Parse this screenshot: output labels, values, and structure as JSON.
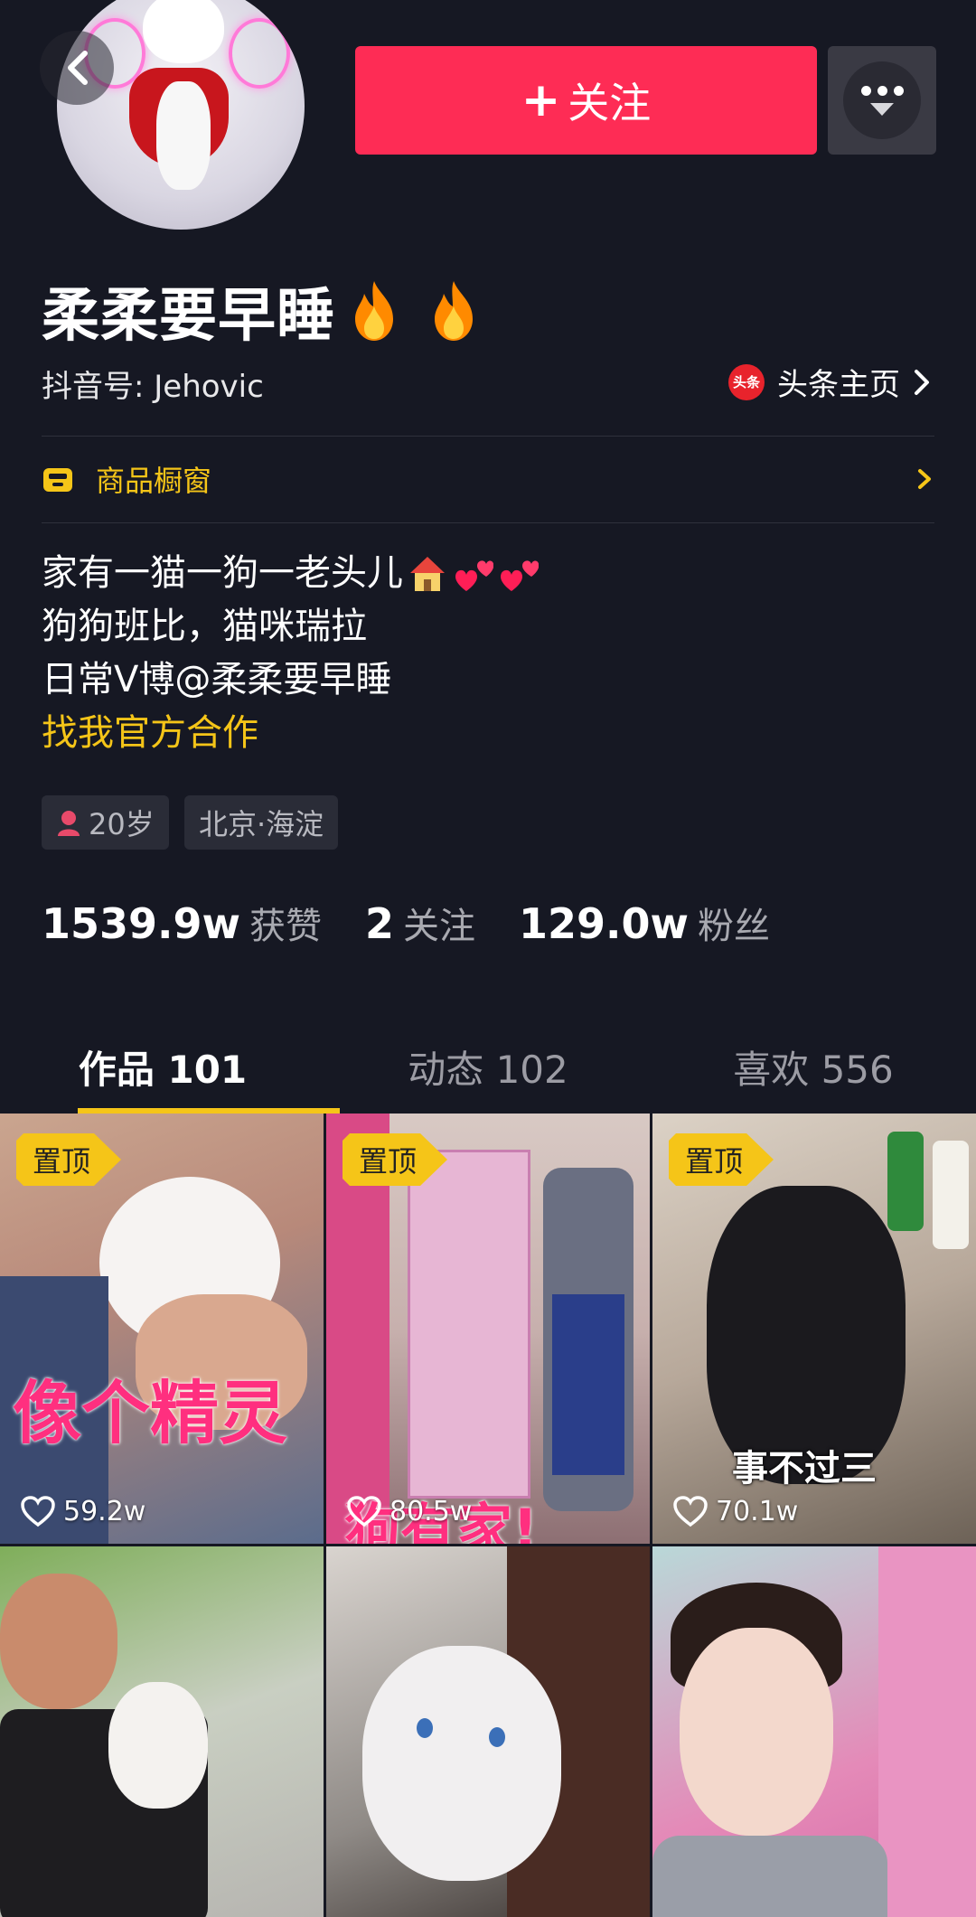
{
  "header": {
    "follow_label": "关注",
    "follow_plus": "+",
    "more_icon": "more-menu-icon",
    "back_icon": "back-arrow-icon"
  },
  "profile": {
    "nickname": "柔柔要早睡",
    "douyin_id": "抖音号: Jehovic",
    "toutiao_logo_text": "头条",
    "toutiao_link": "头条主页",
    "shop_label": "商品橱窗",
    "bio_lines": [
      "家有一猫一狗一老头儿",
      "狗狗班比，猫咪瑞拉",
      "日常V博@柔柔要早睡"
    ],
    "bio_link": "找我官方合作",
    "tags": [
      {
        "label": "20岁",
        "icon": "female-icon"
      },
      {
        "label": "北京·海淀"
      }
    ]
  },
  "stats": [
    {
      "value": "1539.9w",
      "label": "获赞"
    },
    {
      "value": "2",
      "label": "关注"
    },
    {
      "value": "129.0w",
      "label": "粉丝"
    }
  ],
  "tabs": [
    {
      "label": "作品 101",
      "active": true
    },
    {
      "label": "动态 102",
      "active": false
    },
    {
      "label": "喜欢 556",
      "active": false
    }
  ],
  "videos": [
    {
      "pinned": true,
      "pin_label": "置顶",
      "likes": "59.2w",
      "caption": "像个精灵"
    },
    {
      "pinned": true,
      "pin_label": "置顶",
      "likes": "80.5w",
      "caption": "狗有家!"
    },
    {
      "pinned": true,
      "pin_label": "置顶",
      "likes": "70.1w",
      "caption": "事不过三"
    },
    {
      "pinned": false
    },
    {
      "pinned": false
    },
    {
      "pinned": false
    }
  ],
  "colors": {
    "background": "#161823",
    "follow_button": "#fe2c55",
    "accent_yellow": "#f5c518"
  }
}
